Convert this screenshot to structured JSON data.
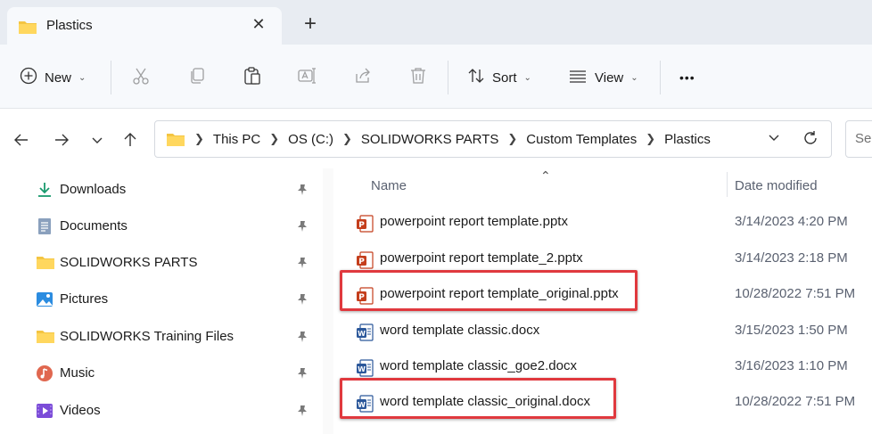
{
  "tab": {
    "title": "Plastics",
    "close_icon": "✕",
    "new_tab_icon": "+"
  },
  "toolbar": {
    "new_label": "New",
    "sort_label": "Sort",
    "view_label": "View",
    "more_label": "•••"
  },
  "breadcrumb": [
    "This PC",
    "OS (C:)",
    "SOLIDWORKS PARTS",
    "Custom Templates",
    "Plastics"
  ],
  "search": {
    "placeholder": "Sea"
  },
  "sidebar": {
    "items": [
      {
        "label": "Downloads",
        "icon": "download-icon"
      },
      {
        "label": "Documents",
        "icon": "documents-icon"
      },
      {
        "label": "SOLIDWORKS PARTS",
        "icon": "folder-icon"
      },
      {
        "label": "Pictures",
        "icon": "pictures-icon"
      },
      {
        "label": "SOLIDWORKS Training Files",
        "icon": "folder-icon"
      },
      {
        "label": "Music",
        "icon": "music-icon"
      },
      {
        "label": "Videos",
        "icon": "videos-icon"
      }
    ]
  },
  "columns": {
    "name": "Name",
    "date": "Date modified"
  },
  "files": [
    {
      "name": "powerpoint report template.pptx",
      "date": "3/14/2023 4:20 PM",
      "type": "pptx",
      "highlighted": false
    },
    {
      "name": "powerpoint report template_2.pptx",
      "date": "3/14/2023 2:18 PM",
      "type": "pptx",
      "highlighted": false
    },
    {
      "name": "powerpoint report template_original.pptx",
      "date": "10/28/2022 7:51 PM",
      "type": "pptx",
      "highlighted": true
    },
    {
      "name": "word template classic.docx",
      "date": "3/15/2023 1:50 PM",
      "type": "docx",
      "highlighted": false
    },
    {
      "name": "word template classic_goe2.docx",
      "date": "3/16/2023 1:10 PM",
      "type": "docx",
      "highlighted": false
    },
    {
      "name": "word template classic_original.docx",
      "date": "10/28/2022 7:51 PM",
      "type": "docx",
      "highlighted": true
    }
  ],
  "colors": {
    "highlight": "#e0393e",
    "pptx": "#c43e1c",
    "docx": "#2b579a",
    "folder": "#f4c542"
  }
}
